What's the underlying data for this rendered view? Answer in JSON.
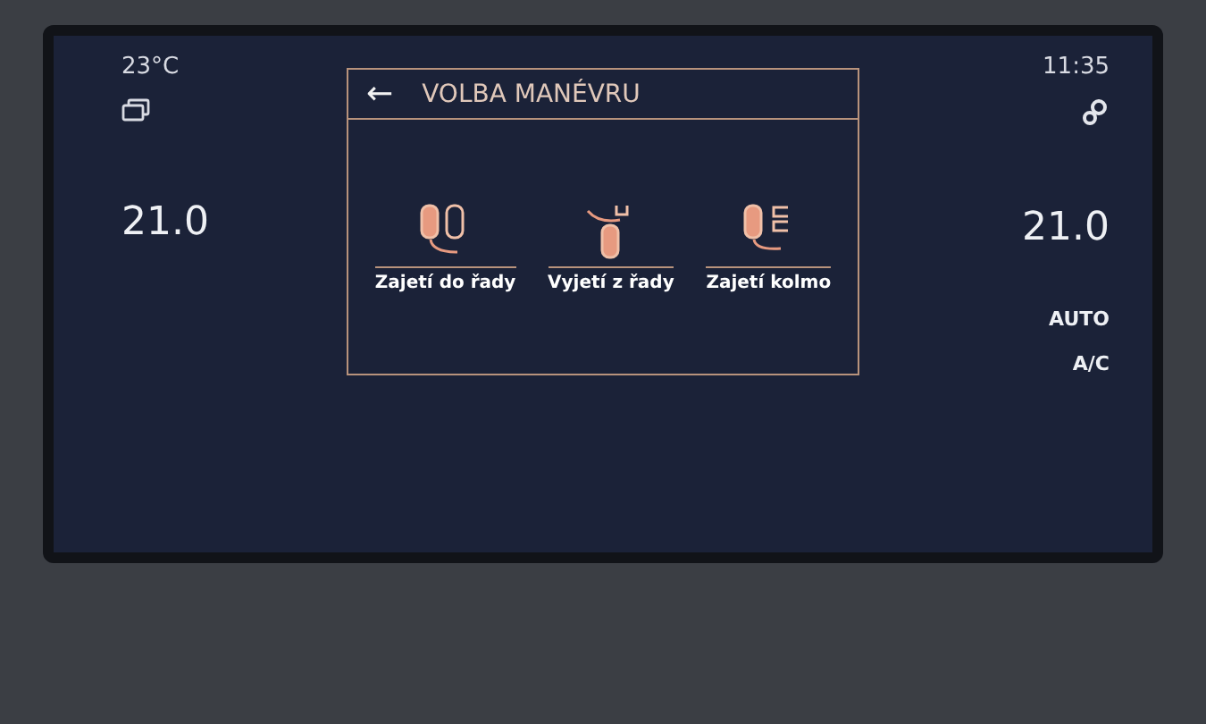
{
  "status": {
    "outside_temp": "23°C",
    "time": "11:35"
  },
  "left_panel": {
    "temperature": "21.0"
  },
  "right_panel": {
    "temperature": "21.0",
    "modes": [
      "AUTO",
      "A/C"
    ]
  },
  "dialog": {
    "back": "←",
    "title": "VOLBA MANÉVRU",
    "options": [
      {
        "kind": "parallel-in",
        "label": "Zajetí do řady"
      },
      {
        "kind": "parallel-out",
        "label": "Vyjetí z řady"
      },
      {
        "kind": "perpendicular",
        "label": "Zajetí kolmo"
      }
    ]
  }
}
